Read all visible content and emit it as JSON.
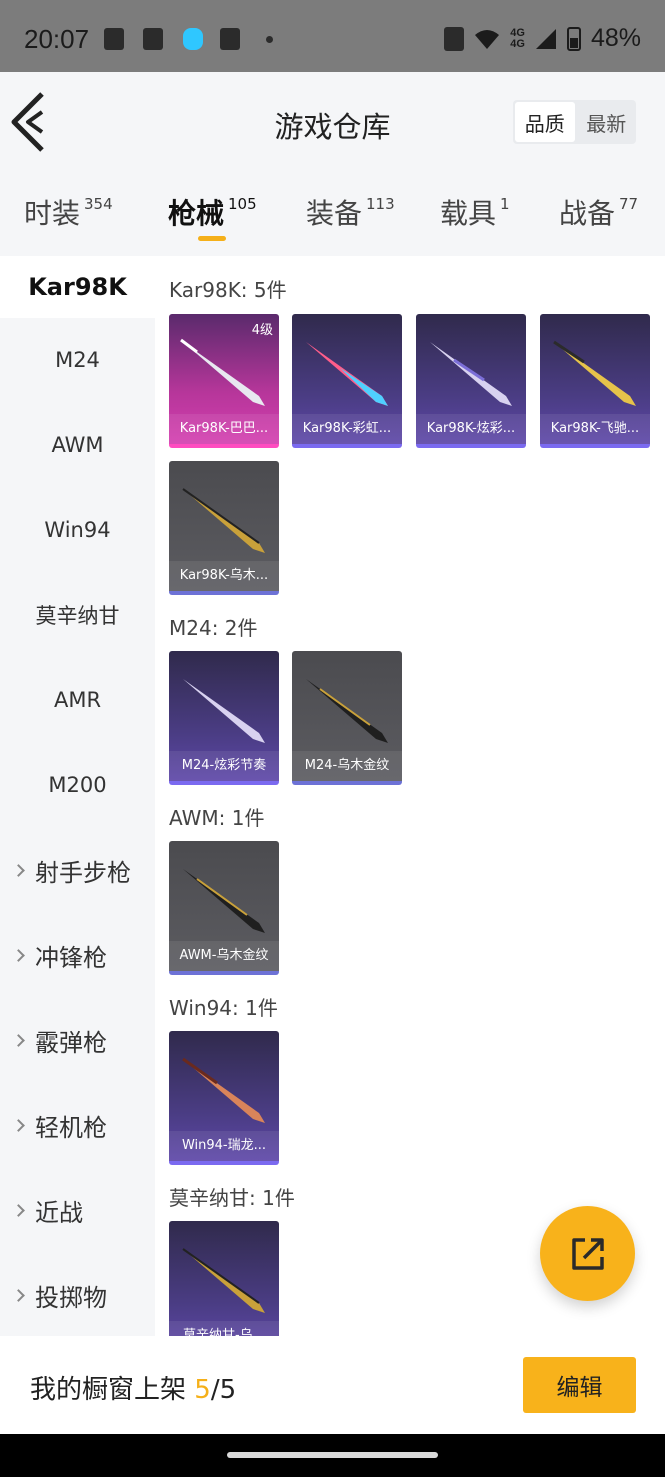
{
  "status_bar": {
    "time": "20:07",
    "network_top": "4G",
    "network_bottom": "4G",
    "battery": "48%"
  },
  "header": {
    "title": "游戏仓库",
    "sort_options": [
      "品质",
      "最新"
    ]
  },
  "tabs": [
    {
      "label": "时装",
      "count": "354"
    },
    {
      "label": "枪械",
      "count": "105"
    },
    {
      "label": "装备",
      "count": "113"
    },
    {
      "label": "载具",
      "count": "1"
    },
    {
      "label": "战备",
      "count": "77"
    }
  ],
  "sidebar": {
    "active": "Kar98K",
    "items": [
      "M24",
      "AWM",
      "Win94",
      "莫辛纳甘",
      "AMR",
      "M200"
    ],
    "groups": [
      "射手步枪",
      "冲锋枪",
      "霰弹枪",
      "轻机枪",
      "近战",
      "投掷物"
    ]
  },
  "sections": [
    {
      "title": "Kar98K: 5件",
      "items": [
        {
          "label": "Kar98K-巴巴...",
          "level": "4级"
        },
        {
          "label": "Kar98K-彩虹..."
        },
        {
          "label": "Kar98K-炫彩..."
        },
        {
          "label": "Kar98K-飞驰..."
        },
        {
          "label": "Kar98K-乌木..."
        }
      ]
    },
    {
      "title": "M24: 2件",
      "items": [
        {
          "label": "M24-炫彩节奏"
        },
        {
          "label": "M24-乌木金纹"
        }
      ]
    },
    {
      "title": "AWM: 1件",
      "items": [
        {
          "label": "AWM-乌木金纹"
        }
      ]
    },
    {
      "title": "Win94: 1件",
      "items": [
        {
          "label": "Win94-瑞龙..."
        }
      ]
    },
    {
      "title": "莫辛纳甘: 1件",
      "items": [
        {
          "label": "莫辛纳甘-乌..."
        }
      ]
    }
  ],
  "bottom_bar": {
    "shelf_label": "我的橱窗上架",
    "shelf_current": "5",
    "shelf_total": "/5",
    "edit_label": "编辑"
  },
  "colors": {
    "accent": "#f8b21b",
    "card_pink": "#d43fb0",
    "card_purple": "#5e47a8",
    "card_grey": "#5c5c61"
  },
  "icons": {
    "back": "chevron-left-icon",
    "fab": "share-external-icon"
  }
}
